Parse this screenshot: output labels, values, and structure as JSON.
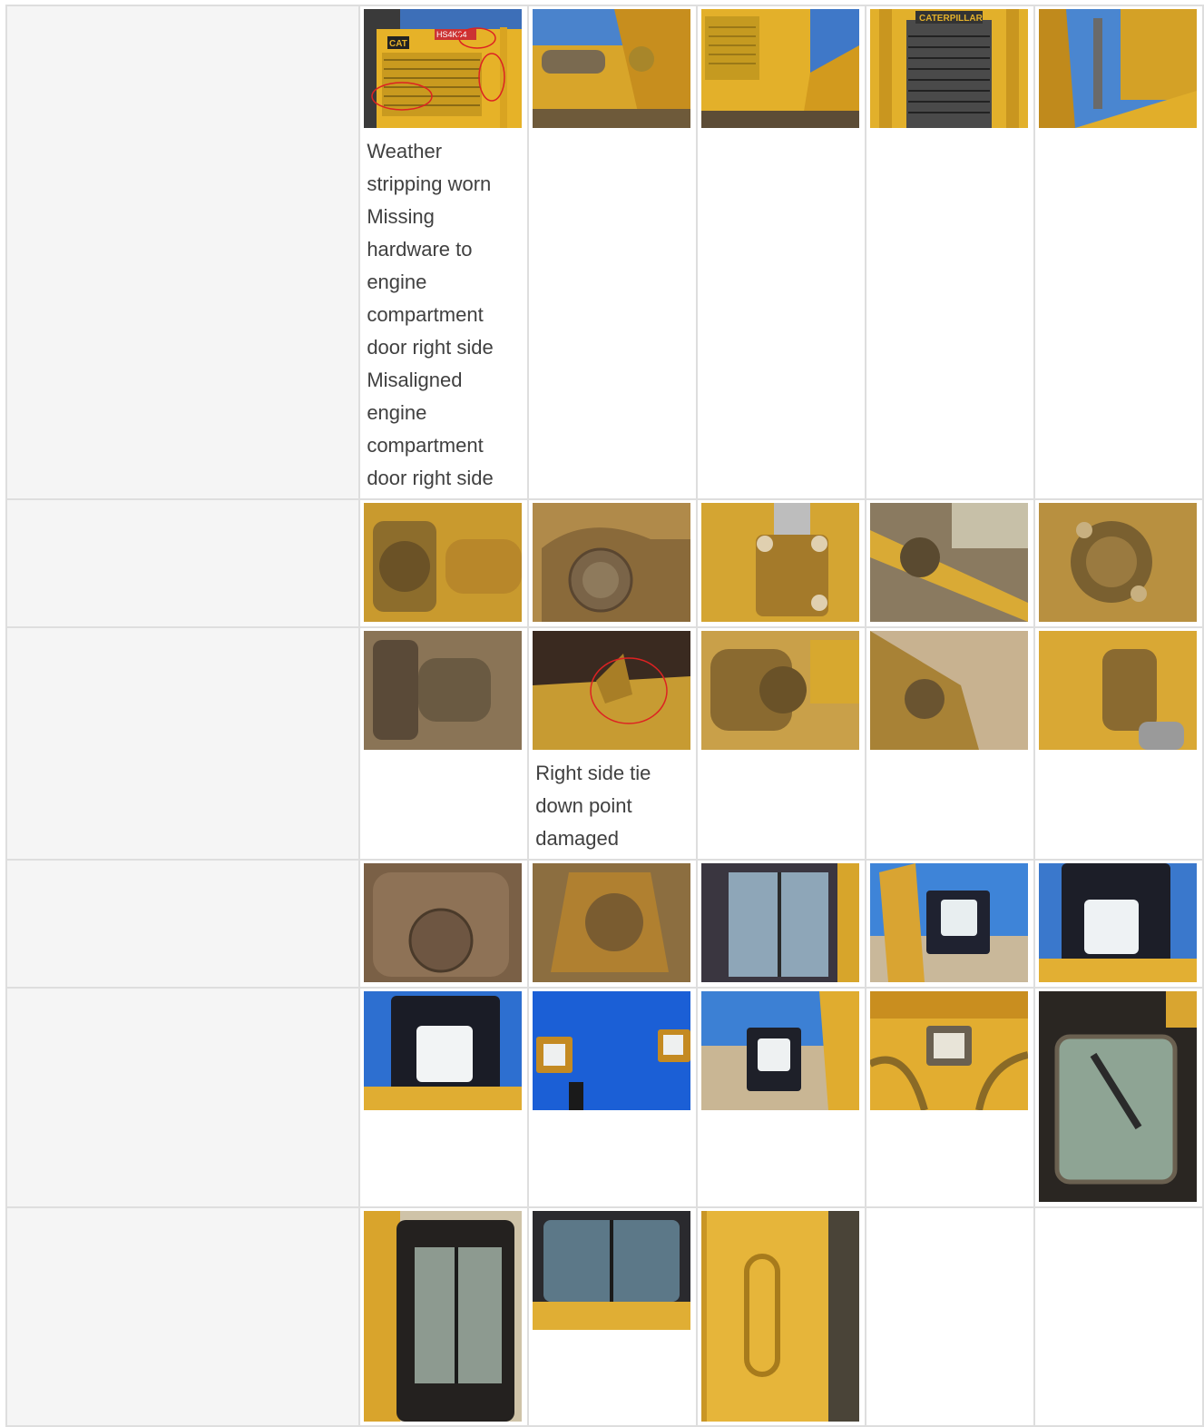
{
  "rows": [
    {
      "photos": [
        {
          "icon": "engine-compartment-photo",
          "note": "Weather stripping worn Missing hardware to engine compartment door right side Misaligned engine compartment door right side",
          "overlay": {
            "badge": "HS4K34",
            "brand": "CAT"
          }
        },
        {
          "icon": "cylinder-mount-photo"
        },
        {
          "icon": "side-panel-photo"
        },
        {
          "icon": "radiator-grille-photo",
          "overlay": {
            "brand": "CATERPILLAR"
          }
        },
        {
          "icon": "lift-arm-photo"
        }
      ]
    },
    {
      "photos": [
        {
          "icon": "pin-joint-photo"
        },
        {
          "icon": "pivot-pin-photo"
        },
        {
          "icon": "bolted-clamp-photo"
        },
        {
          "icon": "linkage-photo"
        },
        {
          "icon": "trunnion-cap-photo"
        }
      ]
    },
    {
      "photos": [
        {
          "icon": "trunnion-photo"
        },
        {
          "icon": "tie-down-point-photo",
          "note": "Right side tie down point damaged"
        },
        {
          "icon": "cylinder-end-photo"
        },
        {
          "icon": "push-arm-photo"
        },
        {
          "icon": "cylinder-clevis-photo"
        }
      ]
    },
    {
      "photos": [
        {
          "icon": "pin-cap-photo"
        },
        {
          "icon": "rod-end-photo"
        },
        {
          "icon": "cab-window-photo"
        },
        {
          "icon": "work-light-photo"
        },
        {
          "icon": "work-light-front-photo"
        }
      ]
    },
    {
      "photos": [
        {
          "icon": "work-light-closeup-photo"
        },
        {
          "icon": "work-lights-sky-photo"
        },
        {
          "icon": "work-light-yard-photo"
        },
        {
          "icon": "rear-light-photo"
        },
        {
          "icon": "cab-door-window-photo"
        }
      ]
    },
    {
      "photos": [
        {
          "icon": "cab-door-photo"
        },
        {
          "icon": "cab-rear-window-photo"
        },
        {
          "icon": "grab-handle-photo"
        }
      ]
    }
  ]
}
